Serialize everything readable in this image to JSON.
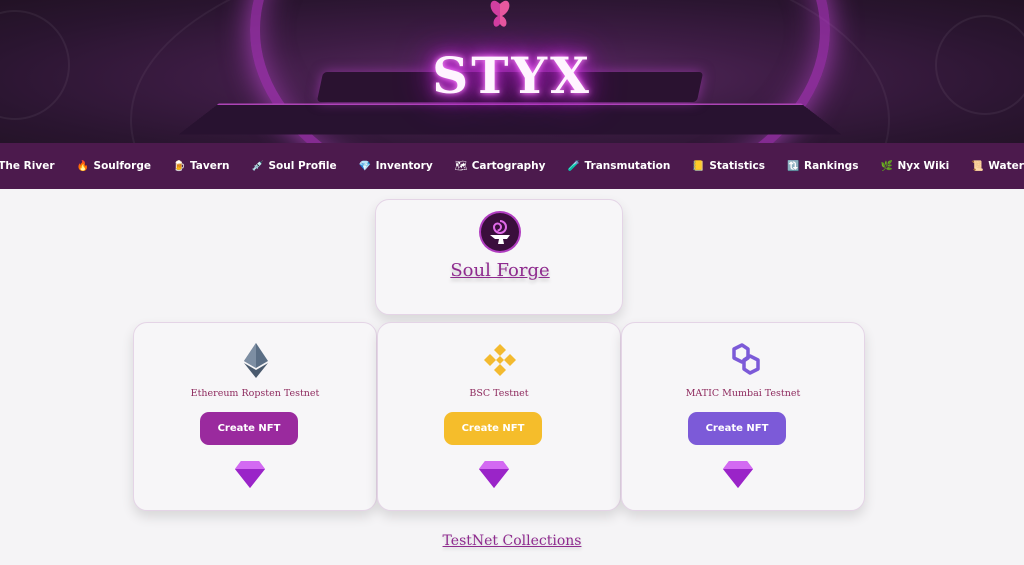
{
  "banner": {
    "title": "STYX"
  },
  "nav": {
    "items": [
      {
        "icon": "droplet-icon",
        "glyph": "💧",
        "label": "The River"
      },
      {
        "icon": "fire-icon",
        "glyph": "🔥",
        "label": "Soulforge"
      },
      {
        "icon": "beer-mug-icon",
        "glyph": "🍺",
        "label": "Tavern"
      },
      {
        "icon": "syringe-icon",
        "glyph": "💉",
        "label": "Soul Profile"
      },
      {
        "icon": "gem-icon",
        "glyph": "💎",
        "label": "Inventory"
      },
      {
        "icon": "map-icon",
        "glyph": "🗺",
        "label": "Cartography"
      },
      {
        "icon": "test-tube-icon",
        "glyph": "🧪",
        "label": "Transmutation"
      },
      {
        "icon": "ledger-icon",
        "glyph": "📒",
        "label": "Statistics"
      },
      {
        "icon": "arrows-cycle-icon",
        "glyph": "🔃",
        "label": "Rankings"
      },
      {
        "icon": "herb-icon",
        "glyph": "🌿",
        "label": "Nyx Wiki"
      },
      {
        "icon": "scroll-icon",
        "glyph": "📜",
        "label": "Waterfall"
      }
    ]
  },
  "forge": {
    "link_label": "Soul Forge"
  },
  "networks": [
    {
      "name": "Ethereum Ropsten Testnet",
      "button_label": "Create NFT",
      "button_color": "#9a2a9e",
      "icon": "ethereum-icon"
    },
    {
      "name": "BSC Testnet",
      "button_label": "Create NFT",
      "button_color": "#f5bd2b",
      "icon": "binance-icon"
    },
    {
      "name": "MATIC Mumbai Testnet",
      "button_label": "Create NFT",
      "button_color": "#7c5ad8",
      "icon": "polygon-icon"
    }
  ],
  "footer": {
    "collections_link": "TestNet Collections"
  },
  "colors": {
    "nav_bg": "#4c1a4d",
    "accent": "#8e2a8e"
  }
}
